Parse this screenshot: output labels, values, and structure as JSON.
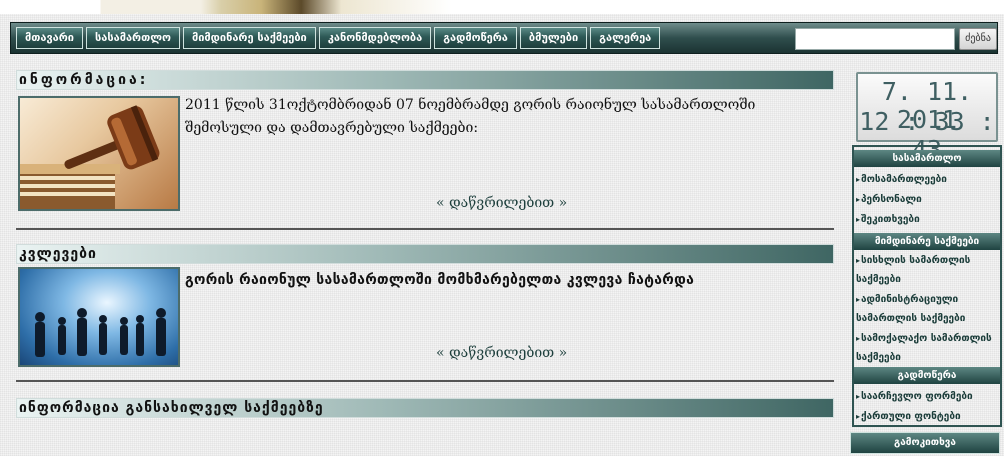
{
  "nav": {
    "items": [
      "მთავარი",
      "სასამართლო",
      "მიმდინარე საქმეები",
      "კანონმდებლობა",
      "გადმოწერა",
      "ბმულები",
      "გალერეა"
    ],
    "search_value": "",
    "search_button": "ძებნა"
  },
  "main": {
    "sections": [
      {
        "title": "ინფორმაცია:",
        "text": "2011 წლის 31ოქტომბრიდან 07 ნოემბრამდე გორის რაიონულ სასამართლოში შემოსული და დამთავრებული საქმეები:",
        "more": "« დაწვრილებით »"
      },
      {
        "title": "კვლევები",
        "text": "გორის რაიონულ სასამართლოში მომხმარებელთა კვლევა ჩატარდა",
        "more": "« დაწვრილებით »"
      },
      {
        "title": "ინფორმაცია განსახილველ საქმეებზე"
      }
    ]
  },
  "clock": {
    "date": "7. 11. 2011",
    "time": "12 : 33 : 43"
  },
  "sidebar": {
    "groups": [
      {
        "title": "სასამართლო",
        "links": [
          "მოსამართლეები",
          "პერსონალი",
          "შეკითხვები"
        ]
      },
      {
        "title": "მიმდინარე საქმეები",
        "links": [
          "სისხლის სამართლის საქმეები",
          "ადმინისტრაციული სამართლის საქმეები",
          "სამოქალაქო სამართლის საქმეები"
        ]
      },
      {
        "title": "გადმოწერა",
        "links": [
          "საარჩევლო ფორმები",
          "ქართული ფონტები"
        ]
      }
    ],
    "bottom_button": "გამოკითხვა"
  }
}
